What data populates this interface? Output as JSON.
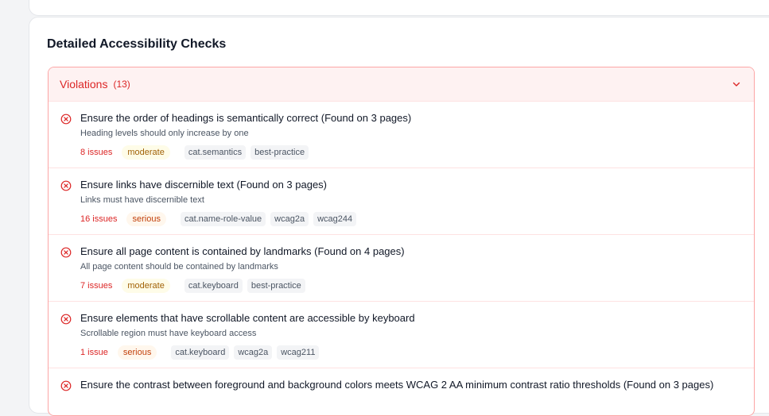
{
  "section_title": "Detailed Accessibility Checks",
  "violations": {
    "title": "Violations",
    "count": "(13)",
    "items": [
      {
        "heading": "Ensure the order of headings is semantically correct (Found on 3 pages)",
        "description": "Heading levels should only increase by one",
        "issues": "8 issues",
        "impact": "moderate",
        "tags": [
          "cat.semantics",
          "best-practice"
        ]
      },
      {
        "heading": "Ensure links have discernible text (Found on 3 pages)",
        "description": "Links must have discernible text",
        "issues": "16 issues",
        "impact": "serious",
        "tags": [
          "cat.name-role-value",
          "wcag2a",
          "wcag244"
        ]
      },
      {
        "heading": "Ensure all page content is contained by landmarks (Found on 4 pages)",
        "description": "All page content should be contained by landmarks",
        "issues": "7 issues",
        "impact": "moderate",
        "tags": [
          "cat.keyboard",
          "best-practice"
        ]
      },
      {
        "heading": "Ensure elements that have scrollable content are accessible by keyboard",
        "description": "Scrollable region must have keyboard access",
        "issues": "1 issue",
        "impact": "serious",
        "tags": [
          "cat.keyboard",
          "wcag2a",
          "wcag211"
        ]
      },
      {
        "heading": "Ensure the contrast between foreground and background colors meets WCAG 2 AA minimum contrast ratio thresholds (Found on 3 pages)",
        "description": "",
        "issues": "",
        "impact": "",
        "tags": []
      }
    ]
  },
  "colors": {
    "violation_red": "#dc2626",
    "moderate_text": "#a16207",
    "serious_text": "#c2410c"
  }
}
